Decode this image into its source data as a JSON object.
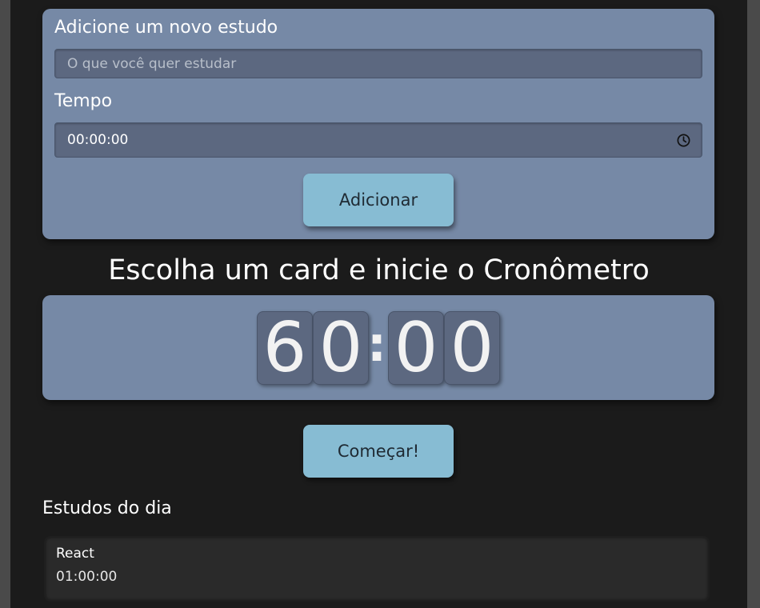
{
  "form": {
    "task_label": "Adicione um novo estudo",
    "task_placeholder": "O que você quer estudar",
    "time_label": "Tempo",
    "time_value": "00:00:00",
    "add_button": "Adicionar"
  },
  "timer": {
    "heading": "Escolha um card e inicie o Cronômetro",
    "digits": [
      "6",
      "0",
      "0",
      "0"
    ],
    "separator": ":",
    "start_button": "Começar!"
  },
  "studies": {
    "title": "Estudos do dia",
    "items": [
      {
        "name": "React",
        "time": "01:00:00"
      }
    ]
  },
  "colors": {
    "page_background": "#1b1b1b",
    "card_background": "#7689a6",
    "input_background": "#5c6880",
    "button_background": "#87bcd3",
    "list_item_background": "#2a2a2a"
  },
  "icons": {
    "time_input": "clock-icon"
  }
}
